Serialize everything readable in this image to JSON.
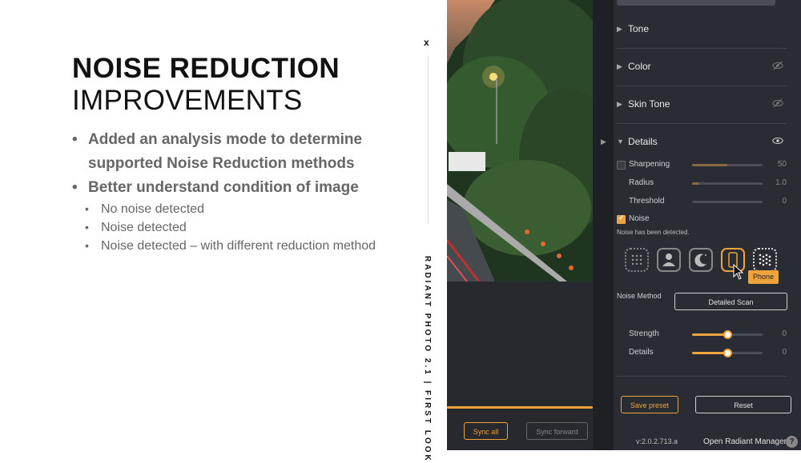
{
  "slide": {
    "title_bold": "NOISE REDUCTION",
    "title_light": "IMPROVEMENTS",
    "bullets": [
      "Added an analysis mode to determine supported Noise Reduction methods",
      "Better understand condition of image"
    ],
    "sub_bullets": [
      "No noise  detected",
      "Noise detected",
      "Noise detected  – with different reduction method"
    ],
    "close_mark": "x",
    "vertical_text": "RADIANT PHOTO 2.1 | FIRST LOOK"
  },
  "panel": {
    "sections": [
      {
        "label": "Tone",
        "eye": false
      },
      {
        "label": "Color",
        "eye": true
      },
      {
        "label": "Skin Tone",
        "eye": true
      },
      {
        "label": "Details",
        "eye": true,
        "expanded": true
      }
    ],
    "details": {
      "sharpening": {
        "label": "Sharpening",
        "value": "50",
        "fraction": 0.5
      },
      "radius": {
        "label": "Radius",
        "value": "1.0",
        "fraction": 0.1
      },
      "threshold": {
        "label": "Threshold",
        "value": "0",
        "fraction": 0.0
      }
    },
    "noise": {
      "label": "Noise",
      "status": "Noise has been detected.",
      "tooltip": "Phone",
      "method_label": "Noise Method",
      "method_value": "Detailed Scan",
      "strength": {
        "label": "Strength",
        "value": "0",
        "fraction": 0.5
      },
      "details_slider": {
        "label": "Details",
        "value": "0",
        "fraction": 0.5
      }
    },
    "save_preset": "Save preset",
    "reset": "Reset",
    "version": "v:2.0.2.713.a",
    "open_manager": "Open Radiant Manager",
    "help": "?"
  },
  "bottom": {
    "sync_all": "Sync all",
    "sync_forward": "Sync forward",
    "progress_fraction": 1.0
  },
  "colors": {
    "accent": "#f1a33b",
    "panel_bg": "#2a2c33"
  }
}
